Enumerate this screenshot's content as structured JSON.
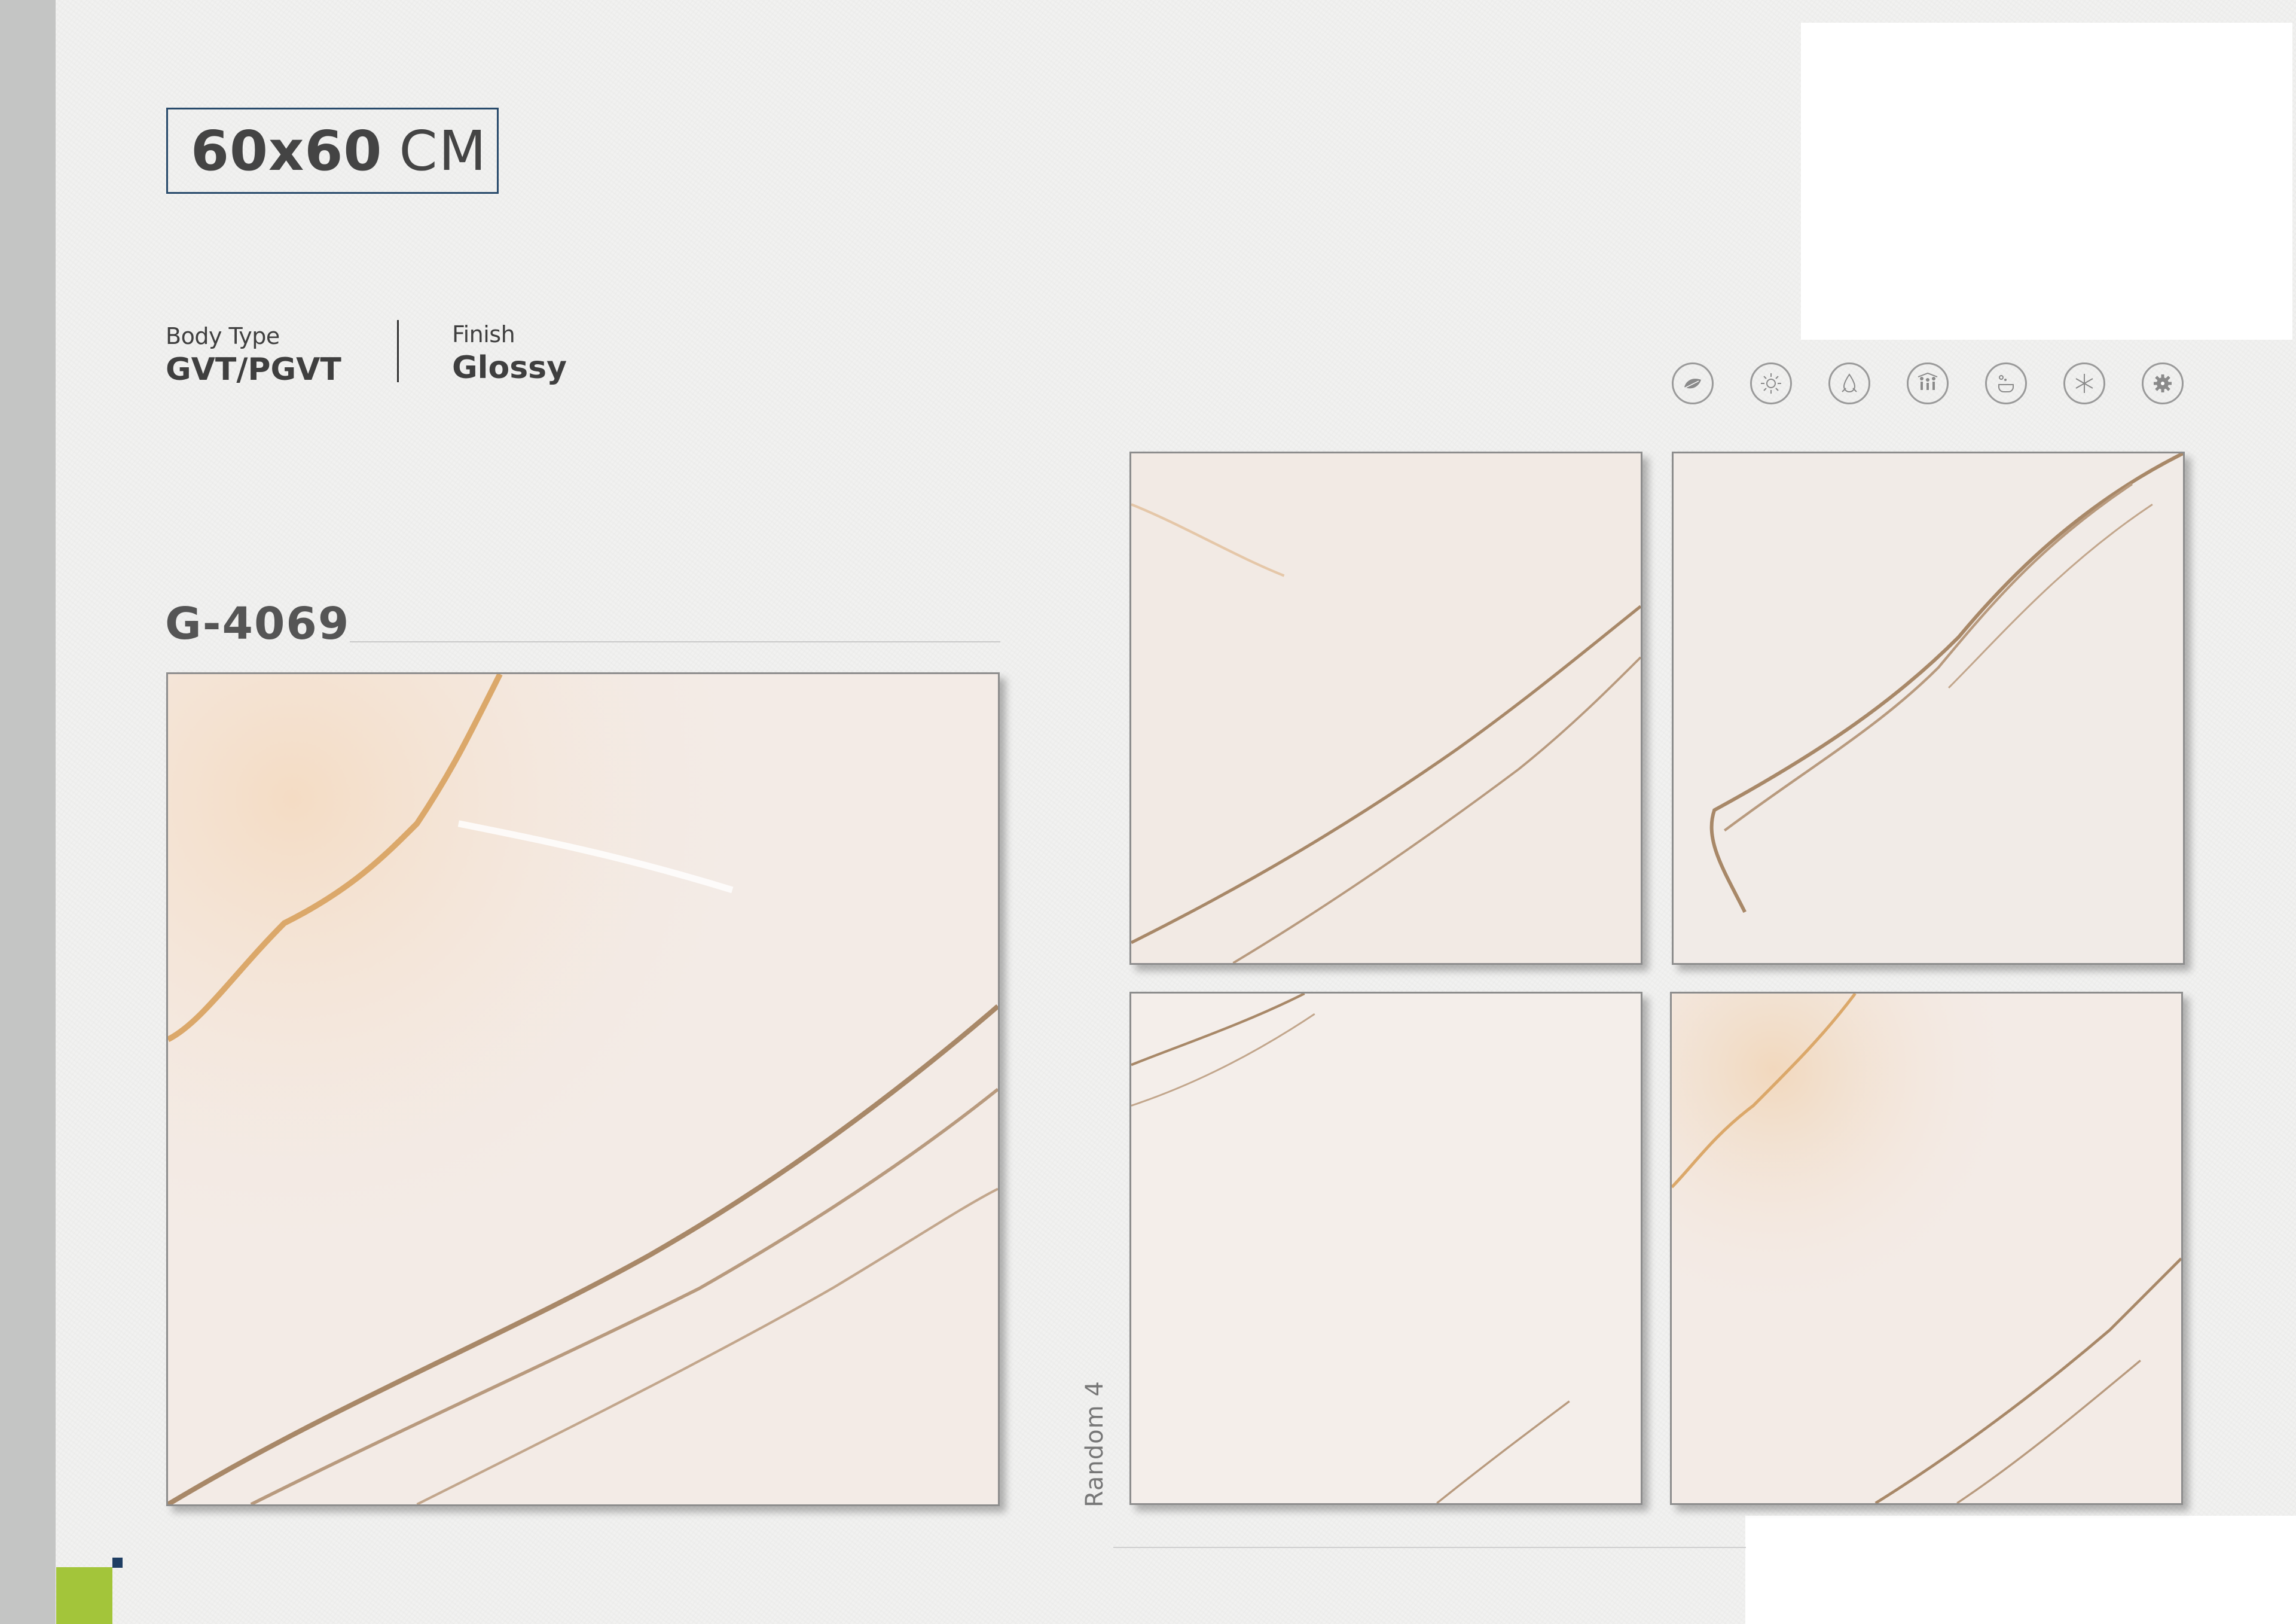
{
  "size": {
    "number": "60x60",
    "unit": "CM"
  },
  "specs": {
    "body_type_label": "Body Type",
    "body_type_value": "GVT/PGVT",
    "finish_label": "Finish",
    "finish_value": "Glossy"
  },
  "product": {
    "code": "G-4069"
  },
  "variation_label": "Random 4",
  "feature_icons": [
    "eco-leaf-icon",
    "sun-icon",
    "water-drop-icon",
    "family-icon",
    "hygiene-icon",
    "frost-icon",
    "gear-icon"
  ],
  "colors": {
    "accent_green": "#a3c53a",
    "accent_navy": "#1f3e63",
    "side_strip": "#c4c5c4",
    "vein_brown": "#a88868",
    "vein_gold": "#dba86a"
  }
}
